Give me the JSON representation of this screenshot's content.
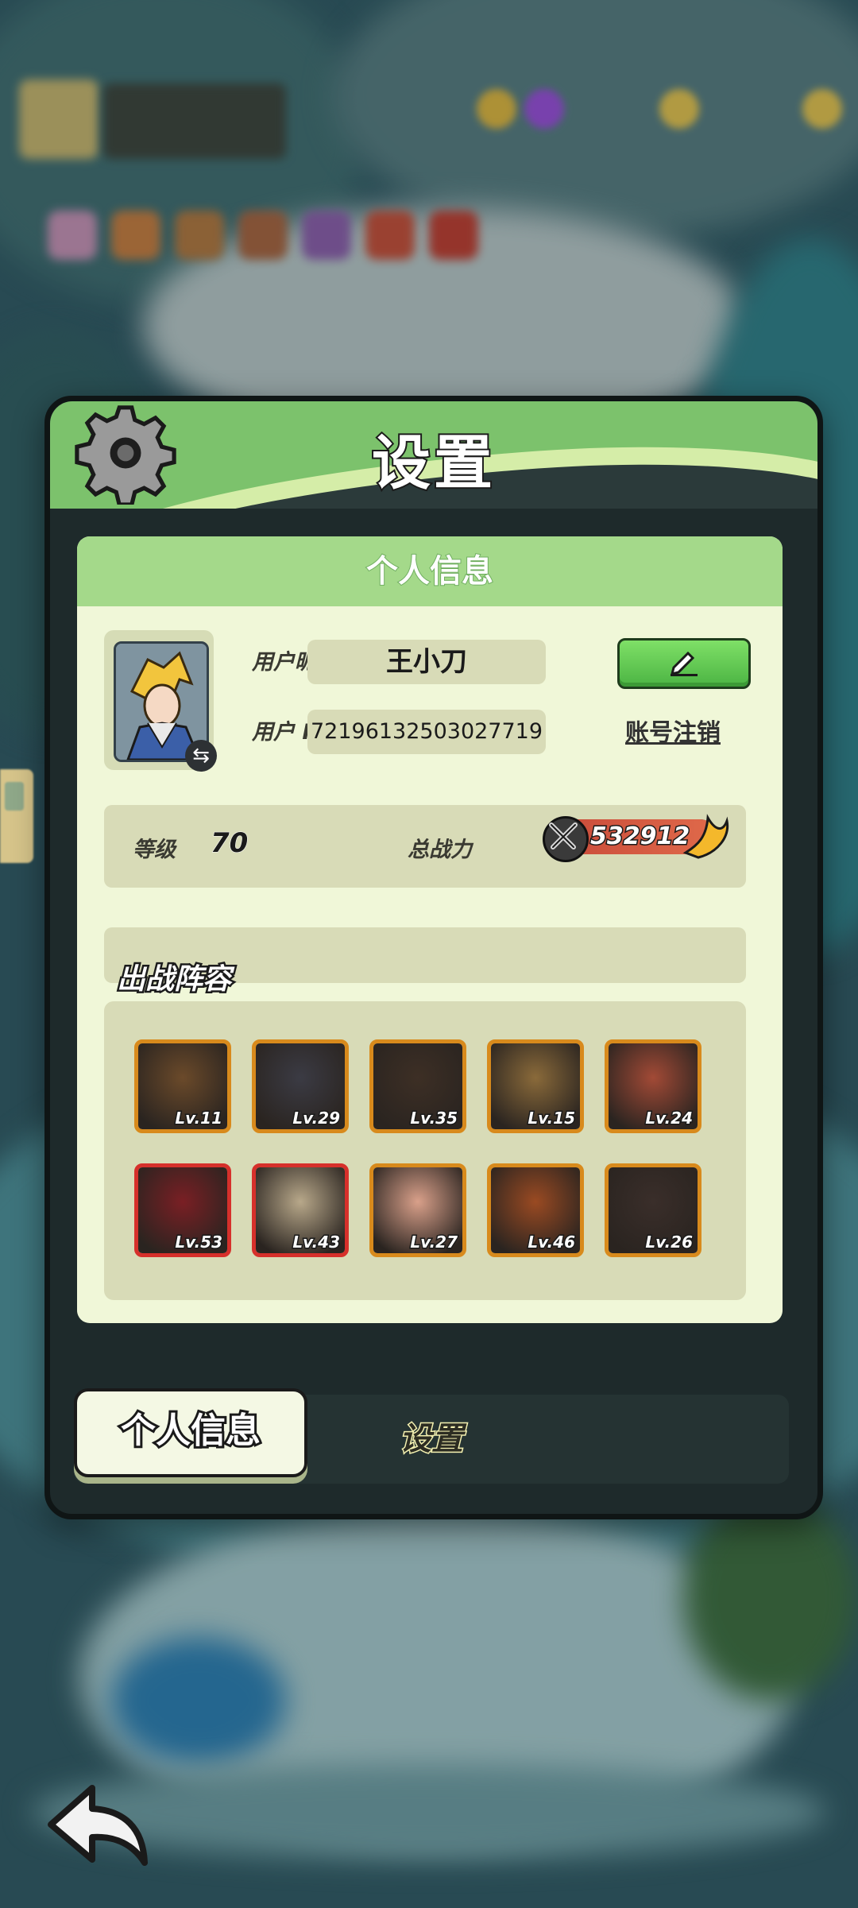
{
  "dialog": {
    "title": "设置",
    "section_header": "个人信息",
    "profile": {
      "nickname_label": "用户昵称",
      "nickname_value": "王小刀",
      "id_label": "用户  ID",
      "id_value": "7219613250302​7719",
      "delete_account_label": "账号注销"
    },
    "stats": {
      "level_label": "等级",
      "level_value": "70",
      "power_label": "总战力",
      "power_value": "532912"
    },
    "lineup": {
      "title": "出战阵容",
      "heroes": [
        {
          "level": "Lv.11",
          "frame": "gold",
          "color": "#6b4a2a"
        },
        {
          "level": "Lv.29",
          "frame": "gold",
          "color": "#3b3b44"
        },
        {
          "level": "Lv.35",
          "frame": "gold",
          "color": "#3d2f25"
        },
        {
          "level": "Lv.15",
          "frame": "gold",
          "color": "#8a6a3a"
        },
        {
          "level": "Lv.24",
          "frame": "gold",
          "color": "#a24a36"
        },
        {
          "level": "Lv.53",
          "frame": "red",
          "color": "#7a1f24"
        },
        {
          "level": "Lv.43",
          "frame": "red",
          "color": "#b8a88a"
        },
        {
          "level": "Lv.27",
          "frame": "gold",
          "color": "#d9a08a"
        },
        {
          "level": "Lv.46",
          "frame": "gold",
          "color": "#9a4a22"
        },
        {
          "level": "Lv.26",
          "frame": "gold",
          "color": "#3a2e2a"
        }
      ]
    },
    "tabs": {
      "personal_info": "个人信息",
      "settings": "设置"
    }
  },
  "icons": {
    "settings": "gear-icon",
    "edit": "pencil-icon",
    "power": "crossed-swords-icon",
    "back": "back-arrow-icon",
    "swap": "swap-icon"
  },
  "colors": {
    "header_green": "#7cc26c",
    "card_bg": "#f0f7d8",
    "button_green": "#4bb443"
  }
}
